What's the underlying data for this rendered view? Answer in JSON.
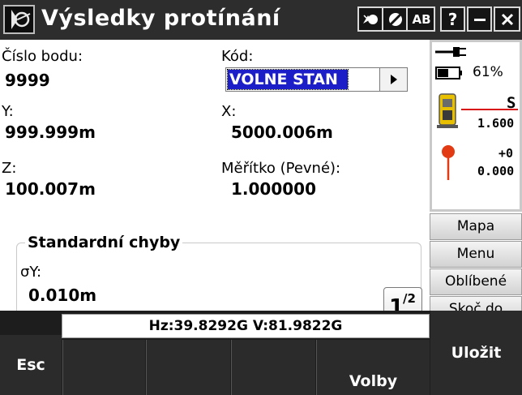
{
  "window": {
    "title": "Výsledky protínání",
    "icons": {
      "app": "tripod-instrument-icon",
      "laser": "laser-pointer-icon",
      "target": "prism-target-icon",
      "help": "?",
      "minimize": "minimize-icon",
      "close": "close-icon"
    },
    "input_mode": "AB"
  },
  "form": {
    "point_number": {
      "label": "Číslo bodu:",
      "value": "9999"
    },
    "code": {
      "label": "Kód:",
      "value": "VOLNE STAN"
    },
    "y": {
      "label": "Y:",
      "value": "999.999m"
    },
    "x": {
      "label": "X:",
      "value": "5000.006m"
    },
    "z": {
      "label": "Z:",
      "value": "100.007m"
    },
    "scale": {
      "label": "Měřítko (Pevné):",
      "value": "1.000000"
    },
    "std_errors": {
      "title": "Standardní chyby",
      "sigma_y": {
        "label": "σY:",
        "value": "0.010m"
      }
    },
    "page": {
      "current": "1",
      "total": "2"
    }
  },
  "status": {
    "power_icon": "power-plug-icon",
    "battery_icon": "battery-icon",
    "battery": "61%",
    "instrument_icon": "total-station-icon",
    "instrument_letter": "S",
    "instrument_height": "1.600",
    "target_icon": "target-pin-icon",
    "target_offset": "+0",
    "target_height": "0.000"
  },
  "side_menu": {
    "map": "Mapa",
    "menu": "Menu",
    "favorites": "Oblíbené",
    "jump": "Skoč do"
  },
  "bottom": {
    "esc": "Esc",
    "hz_v": "Hz:39.8292G  V:81.9822G",
    "options": "Volby",
    "save": "Uložit"
  },
  "colors": {
    "titlebar": "#2d2d2d",
    "selection": "#1c1ec8",
    "instrument": "#e8c000",
    "target_pin": "#e23a12",
    "status_line": "#d81010"
  }
}
